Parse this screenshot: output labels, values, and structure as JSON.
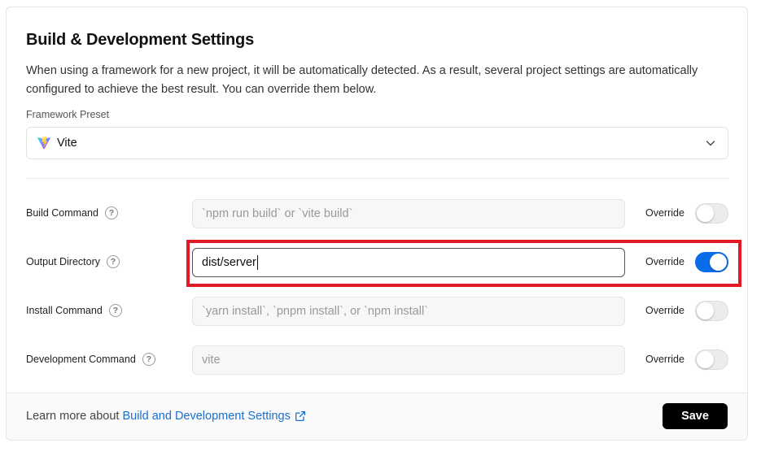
{
  "header": {
    "title": "Build & Development Settings",
    "description": "When using a framework for a new project, it will be automatically detected. As a result, several project settings are automatically configured to achieve the best result. You can override them below."
  },
  "framework": {
    "label": "Framework Preset",
    "selected": "Vite",
    "icon": "vite-logo-icon"
  },
  "settings": [
    {
      "label": "Build Command",
      "placeholder": "`npm run build` or `vite build`",
      "value": "",
      "override_label": "Override",
      "override": false
    },
    {
      "label": "Output Directory",
      "placeholder": "",
      "value": "dist/server",
      "override_label": "Override",
      "override": true
    },
    {
      "label": "Install Command",
      "placeholder": "`yarn install`, `pnpm install`, or `npm install`",
      "value": "",
      "override_label": "Override",
      "override": false
    },
    {
      "label": "Development Command",
      "placeholder": "vite",
      "value": "",
      "override_label": "Override",
      "override": false
    }
  ],
  "footer": {
    "learn_prefix": "Learn more about",
    "learn_link": "Build and Development Settings",
    "save_label": "Save"
  },
  "colors": {
    "accent": "#0a6ce8",
    "link": "#1a6fd1",
    "highlight": "#e01b24"
  }
}
